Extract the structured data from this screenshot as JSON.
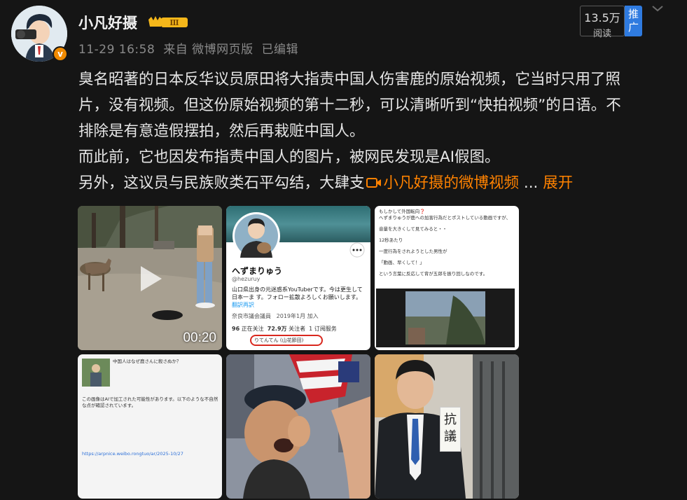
{
  "author": {
    "name": "小凡好摄",
    "level_badge": "Ⅲ",
    "verified_icon": "v-badge"
  },
  "meta": {
    "timestamp": "11-29 16:58",
    "source": "来自 微博网页版",
    "edited": "已编辑"
  },
  "stats": {
    "reads": "13.5万",
    "reads_label": "阅读",
    "promote_label": "推广"
  },
  "post": {
    "line1": "臭名昭著的日本反华议员原田将大指责中国人伤害鹿的原始视频，它当时只用了照",
    "line2": "片，没有视频。但这份原始视频的第十二秒，可以清晰听到“快拍视频”的日语。不",
    "line3": "排除是有意造假摆拍，然后再栽赃中国人。",
    "line4": "而此前，它也因发布指责中国人的图片，被网民发现是AI假图。",
    "line5_prefix": "另外，这议员与民族败类石平勾结，大肆支",
    "video_link": "小凡好摄的微博视频",
    "ellipsis": " ... ",
    "expand": "展开"
  },
  "media": {
    "video_duration": "00:20",
    "twitter_card": {
      "display_name": "へずまりゅう",
      "handle": "@hezuruy",
      "bio": "山口県出身の元迷惑系YouTuberです。今は更生して日本一ま す。フォロー拡散よろしくお願いします。",
      "bio_more": "翻訳再訳",
      "location": "奈良市議会議員",
      "joined": "2019年1月 加入",
      "following_count": "96",
      "following_label": "正在关注",
      "followers_count": "72.9万",
      "followers_label": "关注者",
      "subs": "1 订阅服务",
      "highlight_text": "りてんてん (山花節田)"
    },
    "jp_card": {
      "lines": [
        "もしかして外国転向❓",
        "へずまりゅうが鹿への加害行為だとポストしている動画ですが、",
        "音量を大きくして見てみると・・",
        "12秒あたり",
        "一度行為をされようとした男性が",
        "「動画、早くして！」",
        "という言葉に反応して背が五郎を振り回しなのです。"
      ]
    },
    "gray_card": {
      "header": "中国人はなぜ鹿さんに殺さぬか？",
      "body": "この画像はAIで加工された可能性があります。以下のような不自然な点が確認されています。",
      "link": "https://arpnice.weibo.rongtuo/ar/2025-10/27"
    },
    "protest_sign": "抗議"
  }
}
